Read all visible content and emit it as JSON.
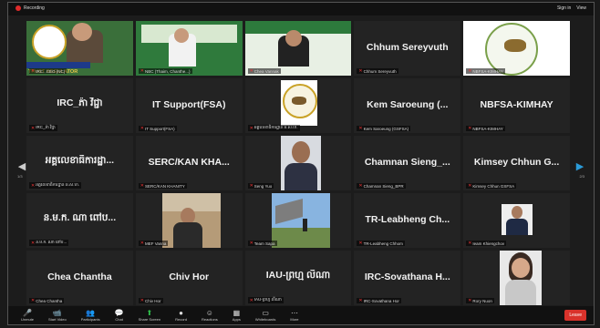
{
  "topbar": {
    "recording": "Recording",
    "sign_in": "Sign in",
    "view": "View"
  },
  "tiles": [
    {
      "name": "",
      "caption": "IRC...CEO (NC)",
      "type": "trust"
    },
    {
      "name": "",
      "caption": "NBC (Thaim, Chanthe...)",
      "type": "banner"
    },
    {
      "name": "",
      "caption": "Chea Vannak",
      "type": "banner2"
    },
    {
      "name": "Chhum Sereyvuth",
      "caption": "Chhum Sereyvuth",
      "type": "text"
    },
    {
      "name": "",
      "caption": "NBFSA-KIMHAY",
      "type": "bull"
    },
    {
      "name": "IRC_ភ៉ា វិជ្ជា",
      "caption": "IRC_ភ៉ា វិជ្ជា",
      "type": "text"
    },
    {
      "name": "IT Support(FSA)",
      "caption": "IT Support(FSA)",
      "type": "text"
    },
    {
      "name": "",
      "caption": "អគ្គលេខាធិការដ្ឋាន អ.ស.ហ.",
      "type": "fsa"
    },
    {
      "name": "Kem Saroeung (...",
      "caption": "Kem Saroeung (GSFSA)",
      "type": "text"
    },
    {
      "name": "NBFSA-KIMHAY",
      "caption": "NBFSA-KIMHAY",
      "type": "text"
    },
    {
      "name": "អគ្គលេខាធិការដ្ឋា...",
      "caption": "អគ្គលេខាធិការដ្ឋាន អ.ស.ហ.",
      "type": "text"
    },
    {
      "name": "SERC/KAN KHA...",
      "caption": "SERC/KAN KHANITY",
      "type": "text"
    },
    {
      "name": "",
      "caption": "Seng Yuo",
      "type": "person1"
    },
    {
      "name": "Chamnan Sieng_...",
      "caption": "Chamnan Sieng_BPR",
      "type": "text"
    },
    {
      "name": "Kimsey Chhun G...",
      "caption": "Kimsey Chhun GSFSA",
      "type": "text"
    },
    {
      "name": "ន.ម.ក. ណា ពៅប...",
      "caption": "ន.ម.ក. ណា ពៅប...",
      "type": "text"
    },
    {
      "name": "",
      "caption": "MEF Vanna",
      "type": "person2"
    },
    {
      "name": "",
      "caption": "Team Sapa",
      "type": "outdoor"
    },
    {
      "name": "TR-Leabheng Ch...",
      "caption": "TR-Leabheng Chhom",
      "type": "text"
    },
    {
      "name": "",
      "caption": "Ieam Khiengchov",
      "type": "person3"
    },
    {
      "name": "Chea Chantha",
      "caption": "Chea Chantha",
      "type": "text"
    },
    {
      "name": "Chiv Hor",
      "caption": "Chiv Hor",
      "type": "text"
    },
    {
      "name": "IAU-ព្រហ្ម លីណា",
      "caption": "IAU-ព្រហ្ម លីណា",
      "type": "text"
    },
    {
      "name": "IRC-Sovathana H...",
      "caption": "IRC-Sovathana Hor",
      "type": "text"
    },
    {
      "name": "",
      "caption": "Rory Nuon",
      "type": "person4"
    }
  ],
  "trust_text": "TRUST REGULATOR",
  "nav": {
    "left_page": "1/3",
    "right_page": "2/3"
  },
  "toolbar": [
    {
      "icon": "mic-icon",
      "label": "Unmute",
      "glyph": "🎤"
    },
    {
      "icon": "video-icon",
      "label": "Start Video",
      "glyph": "📹"
    },
    {
      "icon": "participants-icon",
      "label": "Participants",
      "glyph": "👥"
    },
    {
      "icon": "chat-icon",
      "label": "Chat",
      "glyph": "💬"
    },
    {
      "icon": "share-icon",
      "label": "Share Screen",
      "glyph": "⬆"
    },
    {
      "icon": "record-icon",
      "label": "Record",
      "glyph": "●"
    },
    {
      "icon": "reactions-icon",
      "label": "Reactions",
      "glyph": "☺"
    },
    {
      "icon": "apps-icon",
      "label": "Apps",
      "glyph": "▦"
    },
    {
      "icon": "whiteboard-icon",
      "label": "Whiteboards",
      "glyph": "▭"
    },
    {
      "icon": "more-icon",
      "label": "More",
      "glyph": "⋯"
    }
  ],
  "leave_label": "Leave"
}
